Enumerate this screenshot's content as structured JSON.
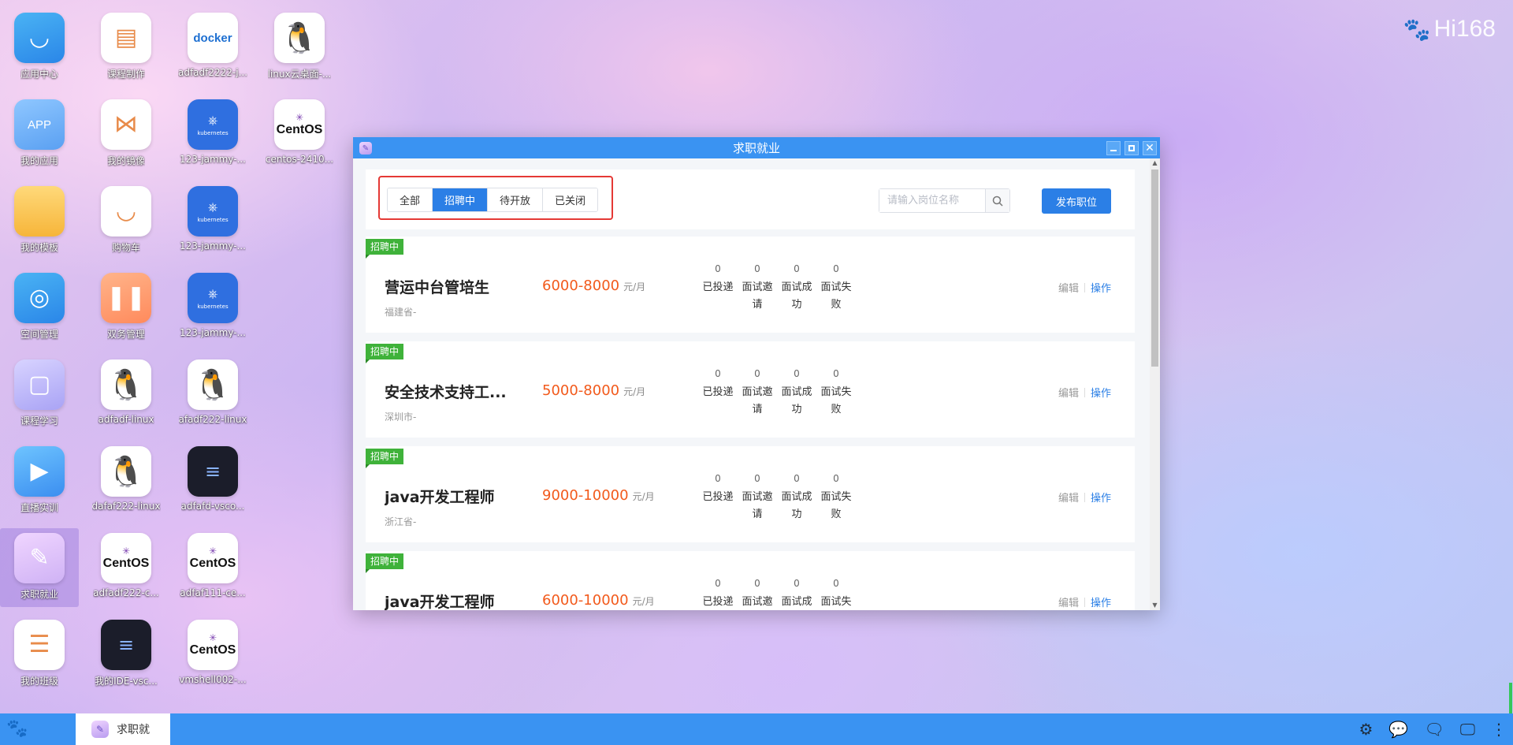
{
  "brand": "Hi168",
  "desktop_icons": [
    {
      "label": "应用中心",
      "icon": "bag-icon"
    },
    {
      "label": "课程制作",
      "icon": "notebook-icon"
    },
    {
      "label": "adfadf2222-j...",
      "icon": "docker-icon"
    },
    {
      "label": "linux云桌面-...",
      "icon": "tux-icon"
    },
    {
      "label": "我的应用",
      "icon": "app-icon"
    },
    {
      "label": "我的镜像",
      "icon": "visual-studio-icon"
    },
    {
      "label": "123-jammy-...",
      "icon": "kubernetes-icon"
    },
    {
      "label": "centos-2410...",
      "icon": "centos-icon"
    },
    {
      "label": "我的模板",
      "icon": "folder-icon"
    },
    {
      "label": "购物车",
      "icon": "cart-icon"
    },
    {
      "label": "123-jammy-...",
      "icon": "kubernetes-icon"
    },
    {
      "label": "空间管理",
      "icon": "space-icon"
    },
    {
      "label": "双务管理",
      "icon": "pause-icon"
    },
    {
      "label": "123-jammy-...",
      "icon": "kubernetes-icon"
    },
    {
      "label": "课程学习",
      "icon": "course-icon"
    },
    {
      "label": "adfadf-linux",
      "icon": "tux-icon"
    },
    {
      "label": "afadf222-linux",
      "icon": "tux-icon"
    },
    {
      "label": "直播实训",
      "icon": "play-icon"
    },
    {
      "label": "dafaf222-linux",
      "icon": "tux-icon"
    },
    {
      "label": "adfafd-vsco...",
      "icon": "code-icon"
    },
    {
      "label": "求职就业",
      "icon": "job-icon"
    },
    {
      "label": "adfadf222-c...",
      "icon": "centos-icon"
    },
    {
      "label": "adfaf111-ce...",
      "icon": "centos-icon"
    },
    {
      "label": "我的班级",
      "icon": "class-icon"
    },
    {
      "label": "我的IDE-vsc...",
      "icon": "code-icon"
    },
    {
      "label": "vmshell002-...",
      "icon": "centos-icon"
    }
  ],
  "icon_text": {
    "app": "APP",
    "docker": "docker",
    "kubernetes": "kubernetes",
    "centos": "CentOS"
  },
  "window": {
    "title": "求职就业",
    "close_glyph": "✕"
  },
  "filters": [
    "全部",
    "招聘中",
    "待开放",
    "已关闭"
  ],
  "active_filter": "招聘中",
  "search": {
    "placeholder": "请输入岗位名称",
    "value": ""
  },
  "publish_label": "发布职位",
  "stat_labels": [
    "已投递",
    "面试邀请",
    "面试成功",
    "面试失败"
  ],
  "edit_label": "编辑",
  "op_label": "操作",
  "jobs": [
    {
      "status": "招聘中",
      "title": "营运中台管培生",
      "location": "福建省-",
      "salary": "6000-8000",
      "unit": "元/月",
      "counts": [
        "0",
        "0",
        "0",
        "0"
      ]
    },
    {
      "status": "招聘中",
      "title": "安全技术支持工...",
      "location": "深圳市-",
      "salary": "5000-8000",
      "unit": "元/月",
      "counts": [
        "0",
        "0",
        "0",
        "0"
      ]
    },
    {
      "status": "招聘中",
      "title": "java开发工程师",
      "location": "浙江省-",
      "salary": "9000-10000",
      "unit": "元/月",
      "counts": [
        "0",
        "0",
        "0",
        "0"
      ]
    },
    {
      "status": "招聘中",
      "title": "java开发工程师",
      "location": "",
      "salary": "6000-10000",
      "unit": "元/月",
      "counts": [
        "0",
        "0",
        "0",
        "0"
      ]
    }
  ],
  "taskbar": {
    "item_label": "求职就"
  },
  "colors": {
    "accent": "#2b7fe6",
    "title_bar": "#3a93f2",
    "salary": "#f25a1c",
    "badge": "#3fb23a",
    "highlight": "#e53935"
  }
}
